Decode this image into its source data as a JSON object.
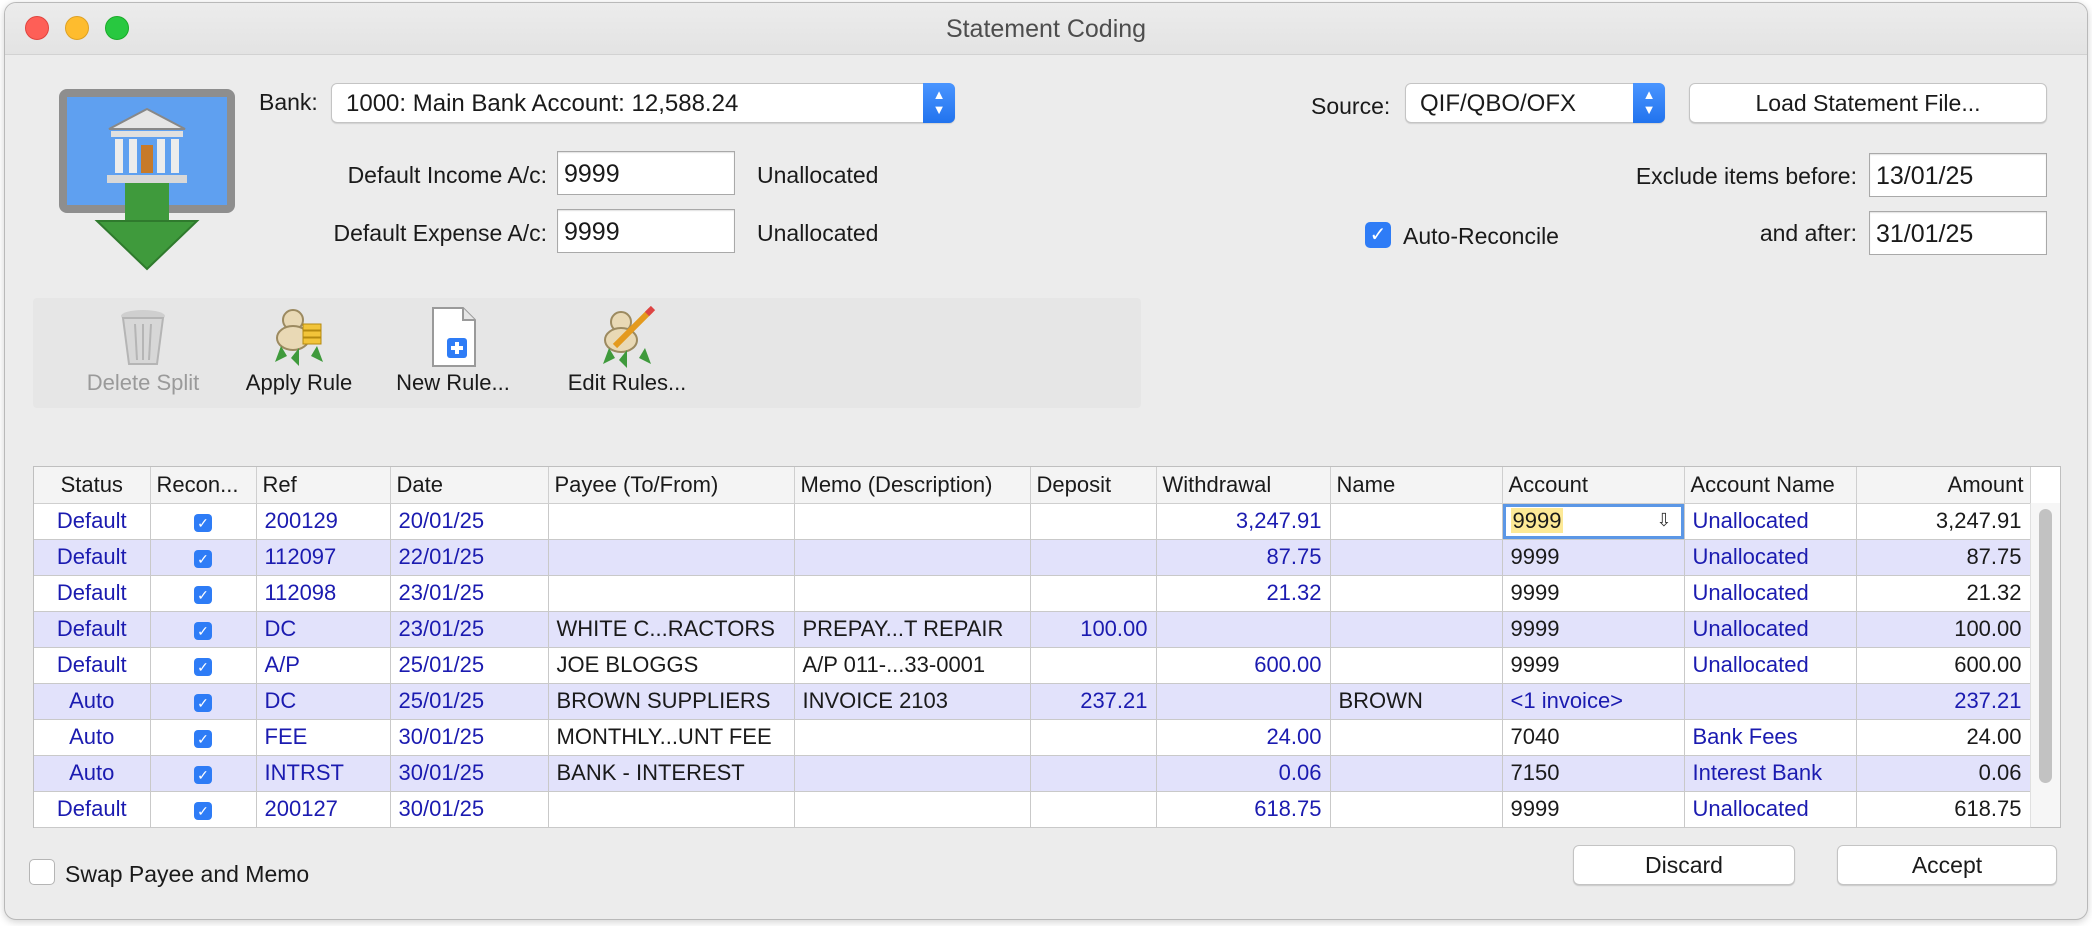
{
  "window": {
    "title": "Statement Coding"
  },
  "bank": {
    "label": "Bank:",
    "value": "1000: Main Bank Account: 12,588.24"
  },
  "defaults": {
    "income_label": "Default Income A/c:",
    "income_value": "9999",
    "income_name": "Unallocated",
    "expense_label": "Default Expense A/c:",
    "expense_value": "9999",
    "expense_name": "Unallocated"
  },
  "source": {
    "label": "Source:",
    "value": "QIF/QBO/OFX"
  },
  "load_button": "Load Statement File...",
  "exclude": {
    "before_label": "Exclude items before:",
    "before_value": "13/01/25",
    "after_label": "and after:",
    "after_value": "31/01/25"
  },
  "auto_reconcile": {
    "label": "Auto-Reconcile",
    "checked": true
  },
  "toolbar": {
    "delete_split": "Delete Split",
    "apply_rule": "Apply Rule",
    "new_rule": "New Rule...",
    "edit_rules": "Edit Rules..."
  },
  "table": {
    "columns": [
      "Status",
      "Recon...",
      "Ref",
      "Date",
      "Payee (To/From)",
      "Memo (Description)",
      "Deposit",
      "Withdrawal",
      "Name",
      "Account",
      "Account Name",
      "Amount"
    ],
    "rows": [
      {
        "status": "Default",
        "recon": true,
        "ref": "200129",
        "date": "20/01/25",
        "payee": "",
        "memo": "",
        "deposit": "",
        "withdrawal": "3,247.91",
        "name": "",
        "account": "9999",
        "account_name": "Unallocated",
        "amount": "3,247.91"
      },
      {
        "status": "Default",
        "recon": true,
        "ref": "112097",
        "date": "22/01/25",
        "payee": "",
        "memo": "",
        "deposit": "",
        "withdrawal": "87.75",
        "name": "",
        "account": "9999",
        "account_name": "Unallocated",
        "amount": "87.75"
      },
      {
        "status": "Default",
        "recon": true,
        "ref": "112098",
        "date": "23/01/25",
        "payee": "",
        "memo": "",
        "deposit": "",
        "withdrawal": "21.32",
        "name": "",
        "account": "9999",
        "account_name": "Unallocated",
        "amount": "21.32"
      },
      {
        "status": "Default",
        "recon": true,
        "ref": "DC",
        "date": "23/01/25",
        "payee": "WHITE C...RACTORS",
        "memo": "PREPAY...T REPAIR",
        "deposit": "100.00",
        "withdrawal": "",
        "name": "",
        "account": "9999",
        "account_name": "Unallocated",
        "amount": "100.00"
      },
      {
        "status": "Default",
        "recon": true,
        "ref": "A/P",
        "date": "25/01/25",
        "payee": "JOE BLOGGS",
        "memo": "A/P 011-...33-0001",
        "deposit": "",
        "withdrawal": "600.00",
        "name": "",
        "account": "9999",
        "account_name": "Unallocated",
        "amount": "600.00"
      },
      {
        "status": "Auto",
        "recon": true,
        "ref": "DC",
        "date": "25/01/25",
        "payee": "BROWN SUPPLIERS",
        "memo": "INVOICE 2103",
        "deposit": "237.21",
        "withdrawal": "",
        "name": "BROWN",
        "account": "<1 invoice>",
        "account_name": "",
        "amount": "237.21"
      },
      {
        "status": "Auto",
        "recon": true,
        "ref": "FEE",
        "date": "30/01/25",
        "payee": "MONTHLY...UNT FEE",
        "memo": "",
        "deposit": "",
        "withdrawal": "24.00",
        "name": "",
        "account": "7040",
        "account_name": "Bank Fees",
        "amount": "24.00"
      },
      {
        "status": "Auto",
        "recon": true,
        "ref": "INTRST",
        "date": "30/01/25",
        "payee": "BANK - INTEREST",
        "memo": "",
        "deposit": "",
        "withdrawal": "0.06",
        "name": "",
        "account": "7150",
        "account_name": "Interest Bank",
        "amount": "0.06"
      },
      {
        "status": "Default",
        "recon": true,
        "ref": "200127",
        "date": "30/01/25",
        "payee": "",
        "memo": "",
        "deposit": "",
        "withdrawal": "618.75",
        "name": "",
        "account": "9999",
        "account_name": "Unallocated",
        "amount": "618.75"
      }
    ]
  },
  "swap": {
    "label": "Swap Payee and Memo",
    "checked": false
  },
  "buttons": {
    "discard": "Discard",
    "accept": "Accept"
  },
  "colors": {
    "link_blue": "#1b1bb0",
    "row_alt": "#e2e2fb",
    "accent": "#2e7cf6",
    "highlight": "#fde996"
  }
}
